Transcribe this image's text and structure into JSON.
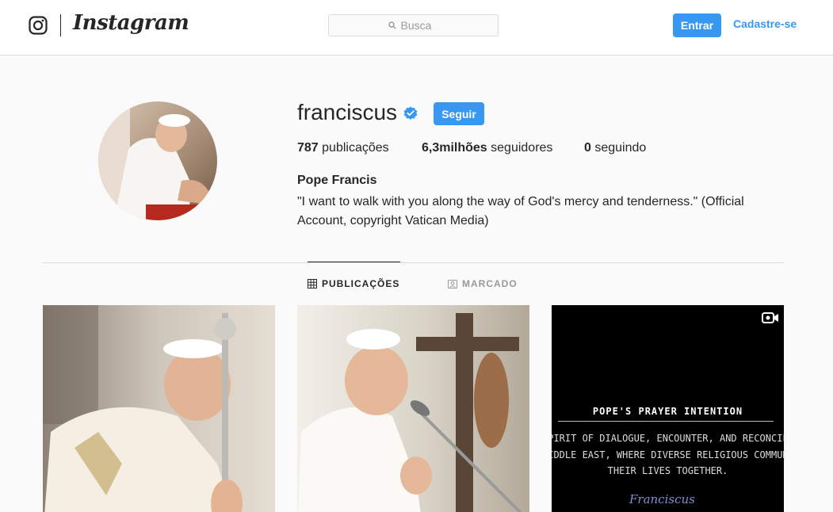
{
  "header": {
    "brand_name": "Instagram",
    "search_placeholder": "Busca",
    "login_label": "Entrar",
    "signup_label": "Cadastre-se"
  },
  "profile": {
    "username": "franciscus",
    "verified": true,
    "follow_label": "Seguir",
    "stats": {
      "posts_count": "787",
      "posts_label": "publicações",
      "followers_count": "6,3milhões",
      "followers_label": "seguidores",
      "following_count": "0",
      "following_label": "seguindo"
    },
    "full_name": "Pope Francis",
    "bio": "\"I want to walk with you along the way of God's mercy and tenderness.\" (Official Account, copyright Vatican Media)"
  },
  "tabs": [
    {
      "label": "PUBLICAÇÕES",
      "icon": "grid-icon",
      "active": true
    },
    {
      "label": "MARCADO",
      "icon": "tagged-icon",
      "active": false
    }
  ],
  "posts": [
    {
      "kind": "photo"
    },
    {
      "kind": "photo"
    },
    {
      "kind": "video",
      "title": "POPE'S PRAYER INTENTION",
      "lines": [
        "SPIRIT OF DIALOGUE, ENCOUNTER, AND RECONCILIATION",
        "MIDDLE EAST, WHERE DIVERSE RELIGIOUS COMMUNITIES",
        "THEIR LIVES TOGETHER."
      ],
      "signature": "Franciscus"
    }
  ],
  "colors": {
    "accent": "#3897f0",
    "text": "#262626",
    "border": "#dbdbdb",
    "background": "#fafafa"
  }
}
